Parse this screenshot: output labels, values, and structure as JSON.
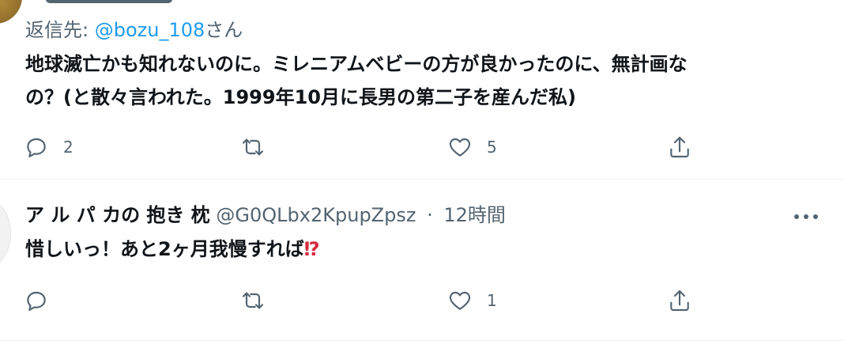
{
  "tweet1": {
    "reply_prefix": "返信先: ",
    "reply_mention": "@bozu_108",
    "reply_suffix": "さん",
    "text_line1": "地球滅亡かも知れないのに。ミレニアムベビーの方が良かったのに、無計画な",
    "text_line2": "の？(と散々言われた。1999年10月に長男の第二子を産んだ私)",
    "replies": "2",
    "retweets": "",
    "likes": "5"
  },
  "tweet2": {
    "display_name": "ア ル パ カの 抱き 枕",
    "handle": "@G0QLbx2KpupZpsz",
    "separator": "·",
    "time": "12時間",
    "text": "惜しいっ！あと2ヶ月我慢すれば",
    "emoji": "⁉",
    "replies": "",
    "retweets": "",
    "likes": "1"
  },
  "icons": {
    "reply": "reply-icon",
    "retweet": "retweet-icon",
    "like": "heart-icon",
    "share": "share-icon",
    "more": "more-icon"
  },
  "colors": {
    "text": "#0f1419",
    "secondary": "#536471",
    "link": "#1d9bf0",
    "emoji_red": "#d42a3d"
  }
}
